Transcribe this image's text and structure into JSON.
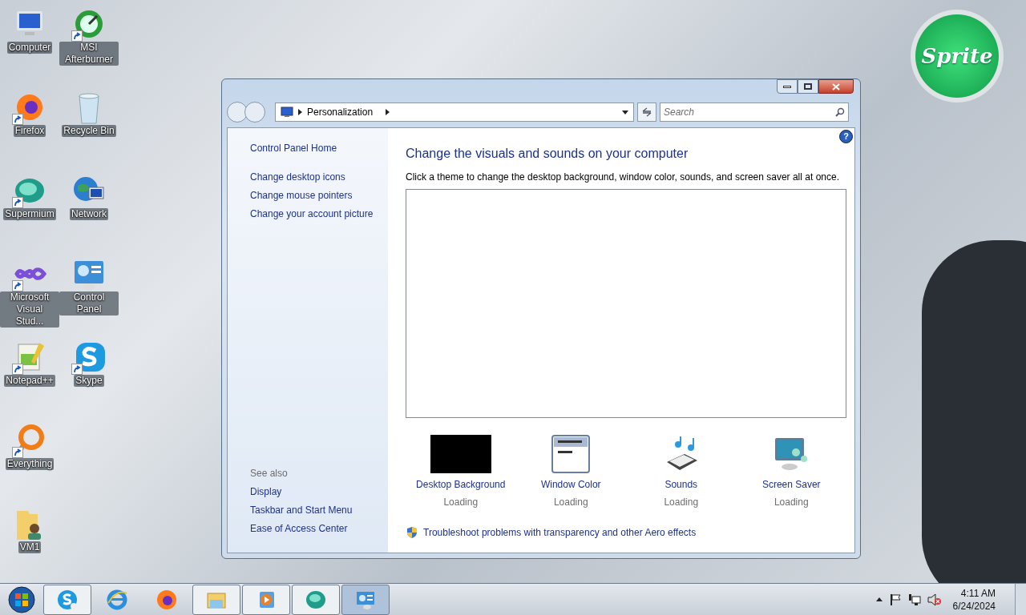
{
  "desktop_columns": [
    [
      {
        "label": "Computer",
        "shortcut": false
      },
      {
        "label": "Firefox",
        "shortcut": true
      },
      {
        "label": "Supermium",
        "shortcut": true
      },
      {
        "label": "Microsoft Visual Stud...",
        "shortcut": true
      },
      {
        "label": "Notepad++",
        "shortcut": true
      },
      {
        "label": "Everything",
        "shortcut": true
      },
      {
        "label": "VM1",
        "shortcut": false
      }
    ],
    [
      {
        "label": "MSI Afterburner",
        "shortcut": true
      },
      {
        "label": "Recycle Bin",
        "shortcut": false
      },
      {
        "label": "Network",
        "shortcut": false
      },
      {
        "label": "Control Panel",
        "shortcut": false
      },
      {
        "label": "Skype",
        "shortcut": true
      }
    ]
  ],
  "gadget": {
    "logo": "Sprite"
  },
  "window": {
    "address": "Personalization",
    "search": {
      "placeholder": "Search"
    },
    "help": "?",
    "sidebar": {
      "links": [
        "Control Panel Home",
        "Change desktop icons",
        "Change mouse pointers",
        "Change your account picture"
      ],
      "see_also_heading": "See also",
      "see_also": [
        "Display",
        "Taskbar and Start Menu",
        "Ease of Access Center"
      ]
    },
    "title": "Change the visuals and sounds on your computer",
    "description": "Click a theme to change the desktop background, window color, sounds, and screen saver all at once.",
    "settings": [
      {
        "label": "Desktop Background",
        "status": "Loading"
      },
      {
        "label": "Window Color",
        "status": "Loading"
      },
      {
        "label": "Sounds",
        "status": "Loading"
      },
      {
        "label": "Screen Saver",
        "status": "Loading"
      }
    ],
    "troubleshoot_link": "Troubleshoot problems with transparency and other Aero effects"
  },
  "taskbar": {
    "items": [
      {
        "running": true,
        "selected": false
      },
      {
        "running": false,
        "selected": false
      },
      {
        "running": false,
        "selected": false
      },
      {
        "running": true,
        "selected": false
      },
      {
        "running": true,
        "selected": false
      },
      {
        "running": true,
        "selected": false
      },
      {
        "running": true,
        "selected": true
      }
    ],
    "time": "4:11 AM",
    "date": "6/24/2024"
  }
}
